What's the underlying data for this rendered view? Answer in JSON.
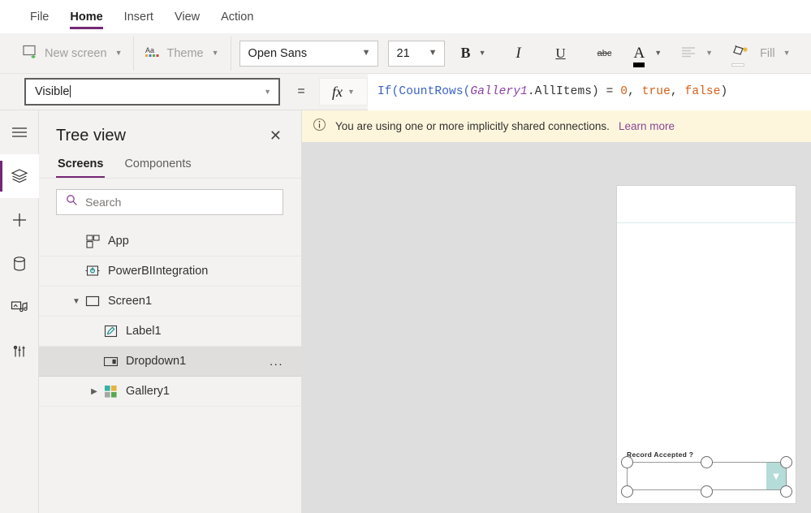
{
  "menu": {
    "items": [
      {
        "label": "File",
        "active": false
      },
      {
        "label": "Home",
        "active": true
      },
      {
        "label": "Insert",
        "active": false
      },
      {
        "label": "View",
        "active": false
      },
      {
        "label": "Action",
        "active": false
      }
    ]
  },
  "ribbon": {
    "new_screen_label": "New screen",
    "theme_label": "Theme",
    "font_family_value": "Open Sans",
    "font_size_value": "21",
    "bold_label": "B",
    "italic_label": "I",
    "underline_label": "U",
    "strikethrough_label": "abc",
    "font_color_label": "A",
    "align_label": "align",
    "fill_label": "Fill"
  },
  "formula": {
    "property_value": "Visible",
    "equals": "=",
    "fx_label": "fx",
    "expression": "If(CountRows(Gallery1.AllItems) = 0, true, false)",
    "tokens": [
      {
        "t": "If(",
        "c": "fn"
      },
      {
        "t": "CountRows(",
        "c": "fn"
      },
      {
        "t": "Gallery1",
        "c": "var"
      },
      {
        "t": ".AllItems)",
        "c": "txt"
      },
      {
        "t": " = ",
        "c": "op"
      },
      {
        "t": "0",
        "c": "num"
      },
      {
        "t": ", ",
        "c": "txt"
      },
      {
        "t": "true",
        "c": "num"
      },
      {
        "t": ", ",
        "c": "txt"
      },
      {
        "t": "false",
        "c": "num"
      },
      {
        "t": ")",
        "c": "txt"
      }
    ]
  },
  "rail": {
    "items": [
      {
        "name": "hamburger-menu-icon",
        "active": false
      },
      {
        "name": "tree-view-icon",
        "active": true
      },
      {
        "name": "insert-icon",
        "active": false
      },
      {
        "name": "data-icon",
        "active": false
      },
      {
        "name": "media-icon",
        "active": false
      },
      {
        "name": "advanced-tools-icon",
        "active": false
      }
    ]
  },
  "tree": {
    "title": "Tree view",
    "tabs": [
      {
        "label": "Screens",
        "active": true
      },
      {
        "label": "Components",
        "active": false
      }
    ],
    "search_placeholder": "Search",
    "items": [
      {
        "label": "App",
        "icon": "app-icon",
        "indent": 0,
        "twisty": "",
        "selected": false,
        "menu": false
      },
      {
        "label": "PowerBIIntegration",
        "icon": "powerbi-icon",
        "indent": 0,
        "twisty": "",
        "selected": false,
        "menu": false
      },
      {
        "label": "Screen1",
        "icon": "screen-icon",
        "indent": 0,
        "twisty": "expanded",
        "selected": false,
        "menu": false
      },
      {
        "label": "Label1",
        "icon": "label-icon",
        "indent": 1,
        "twisty": "",
        "selected": false,
        "menu": false
      },
      {
        "label": "Dropdown1",
        "icon": "dropdown-icon",
        "indent": 1,
        "twisty": "",
        "selected": true,
        "menu": true
      },
      {
        "label": "Gallery1",
        "icon": "gallery-icon",
        "indent": 1,
        "twisty": "collapsed",
        "selected": false,
        "menu": false
      }
    ],
    "overflow_menu_label": "..."
  },
  "notice": {
    "text": "You are using one or more implicitly shared connections.",
    "link": "Learn more"
  },
  "canvas": {
    "dropdown_label": "Record Accepted ?",
    "dropdown_value": ""
  },
  "colors": {
    "accent_purple": "#742774",
    "notice_bg": "#fdf6dd",
    "notice_link": "#8a4596",
    "canvas_bg": "#dedede",
    "dropdown_chevron_bg": "#b5dcd9",
    "ribbon_bg": "#f3f2f1"
  }
}
